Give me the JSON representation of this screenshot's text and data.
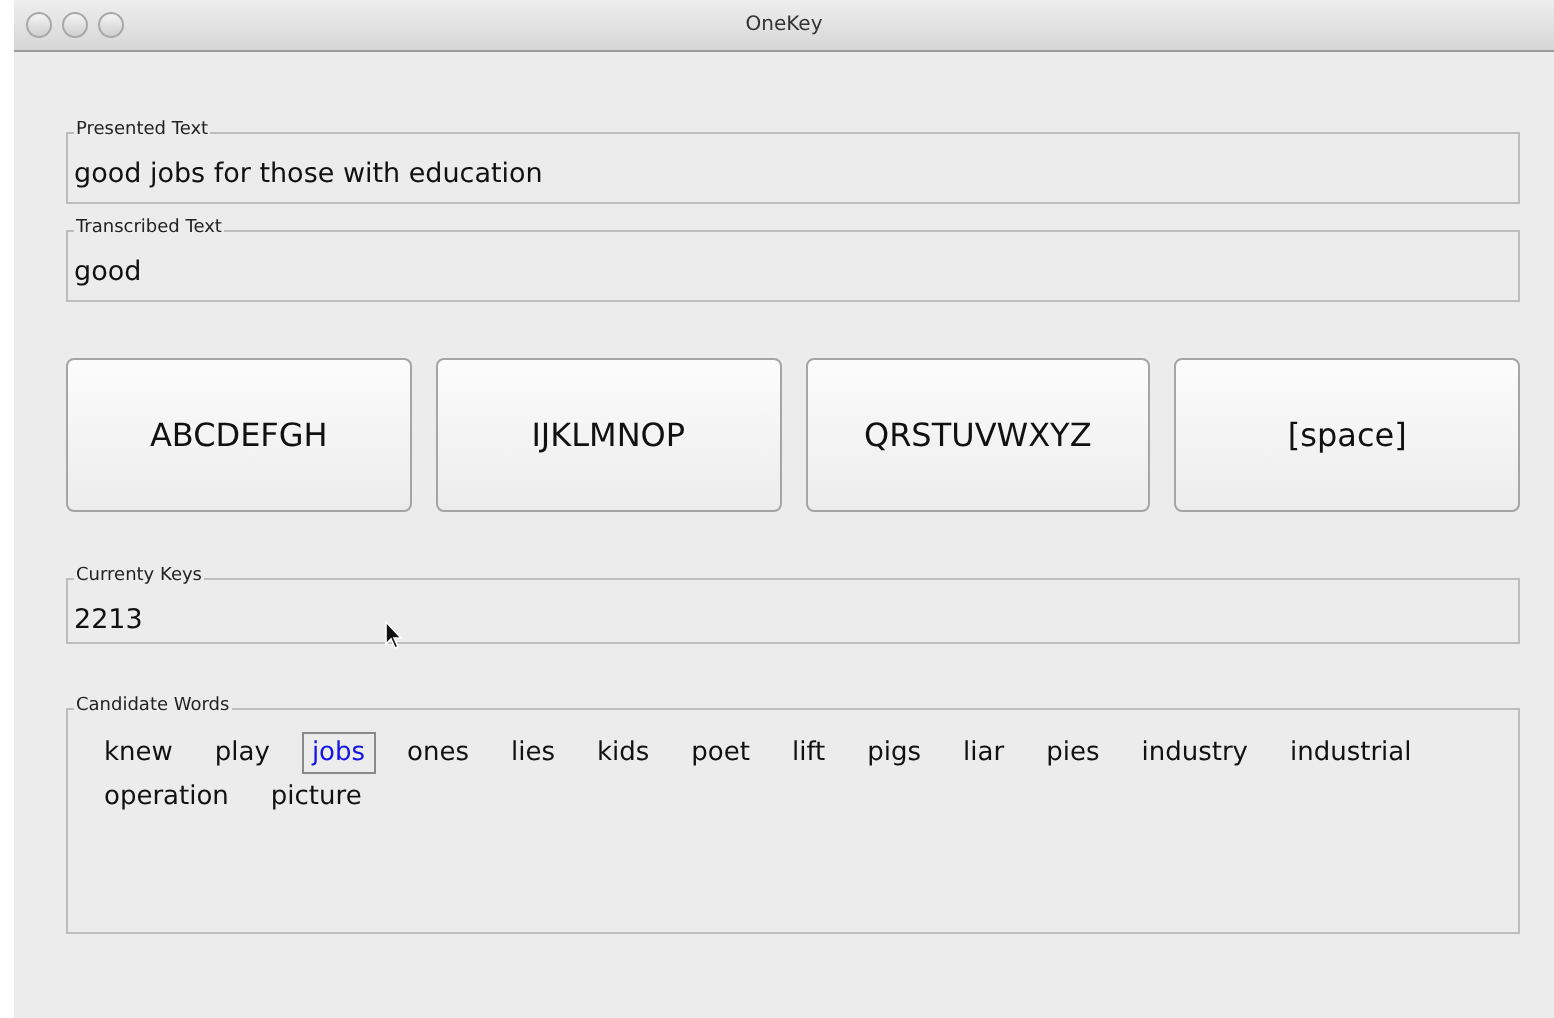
{
  "window": {
    "title": "OneKey"
  },
  "presented_text": {
    "label": "Presented Text",
    "value": "good jobs for those with education"
  },
  "transcribed_text": {
    "label": "Transcribed Text",
    "value": "good"
  },
  "keys": [
    "ABCDEFGH",
    "IJKLMNOP",
    "QRSTUVWXYZ",
    "[space]"
  ],
  "current_keys": {
    "label": "Currenty Keys",
    "value": "2213"
  },
  "candidate_words": {
    "label": "Candidate Words",
    "words": [
      {
        "text": "knew",
        "selected": false
      },
      {
        "text": "play",
        "selected": false
      },
      {
        "text": "jobs",
        "selected": true
      },
      {
        "text": "ones",
        "selected": false
      },
      {
        "text": "lies",
        "selected": false
      },
      {
        "text": "kids",
        "selected": false
      },
      {
        "text": "poet",
        "selected": false
      },
      {
        "text": "lift",
        "selected": false
      },
      {
        "text": "pigs",
        "selected": false
      },
      {
        "text": "liar",
        "selected": false
      },
      {
        "text": "pies",
        "selected": false
      },
      {
        "text": "industry",
        "selected": false
      },
      {
        "text": "industrial",
        "selected": false
      },
      {
        "text": "operation",
        "selected": false
      },
      {
        "text": "picture",
        "selected": false
      }
    ]
  }
}
